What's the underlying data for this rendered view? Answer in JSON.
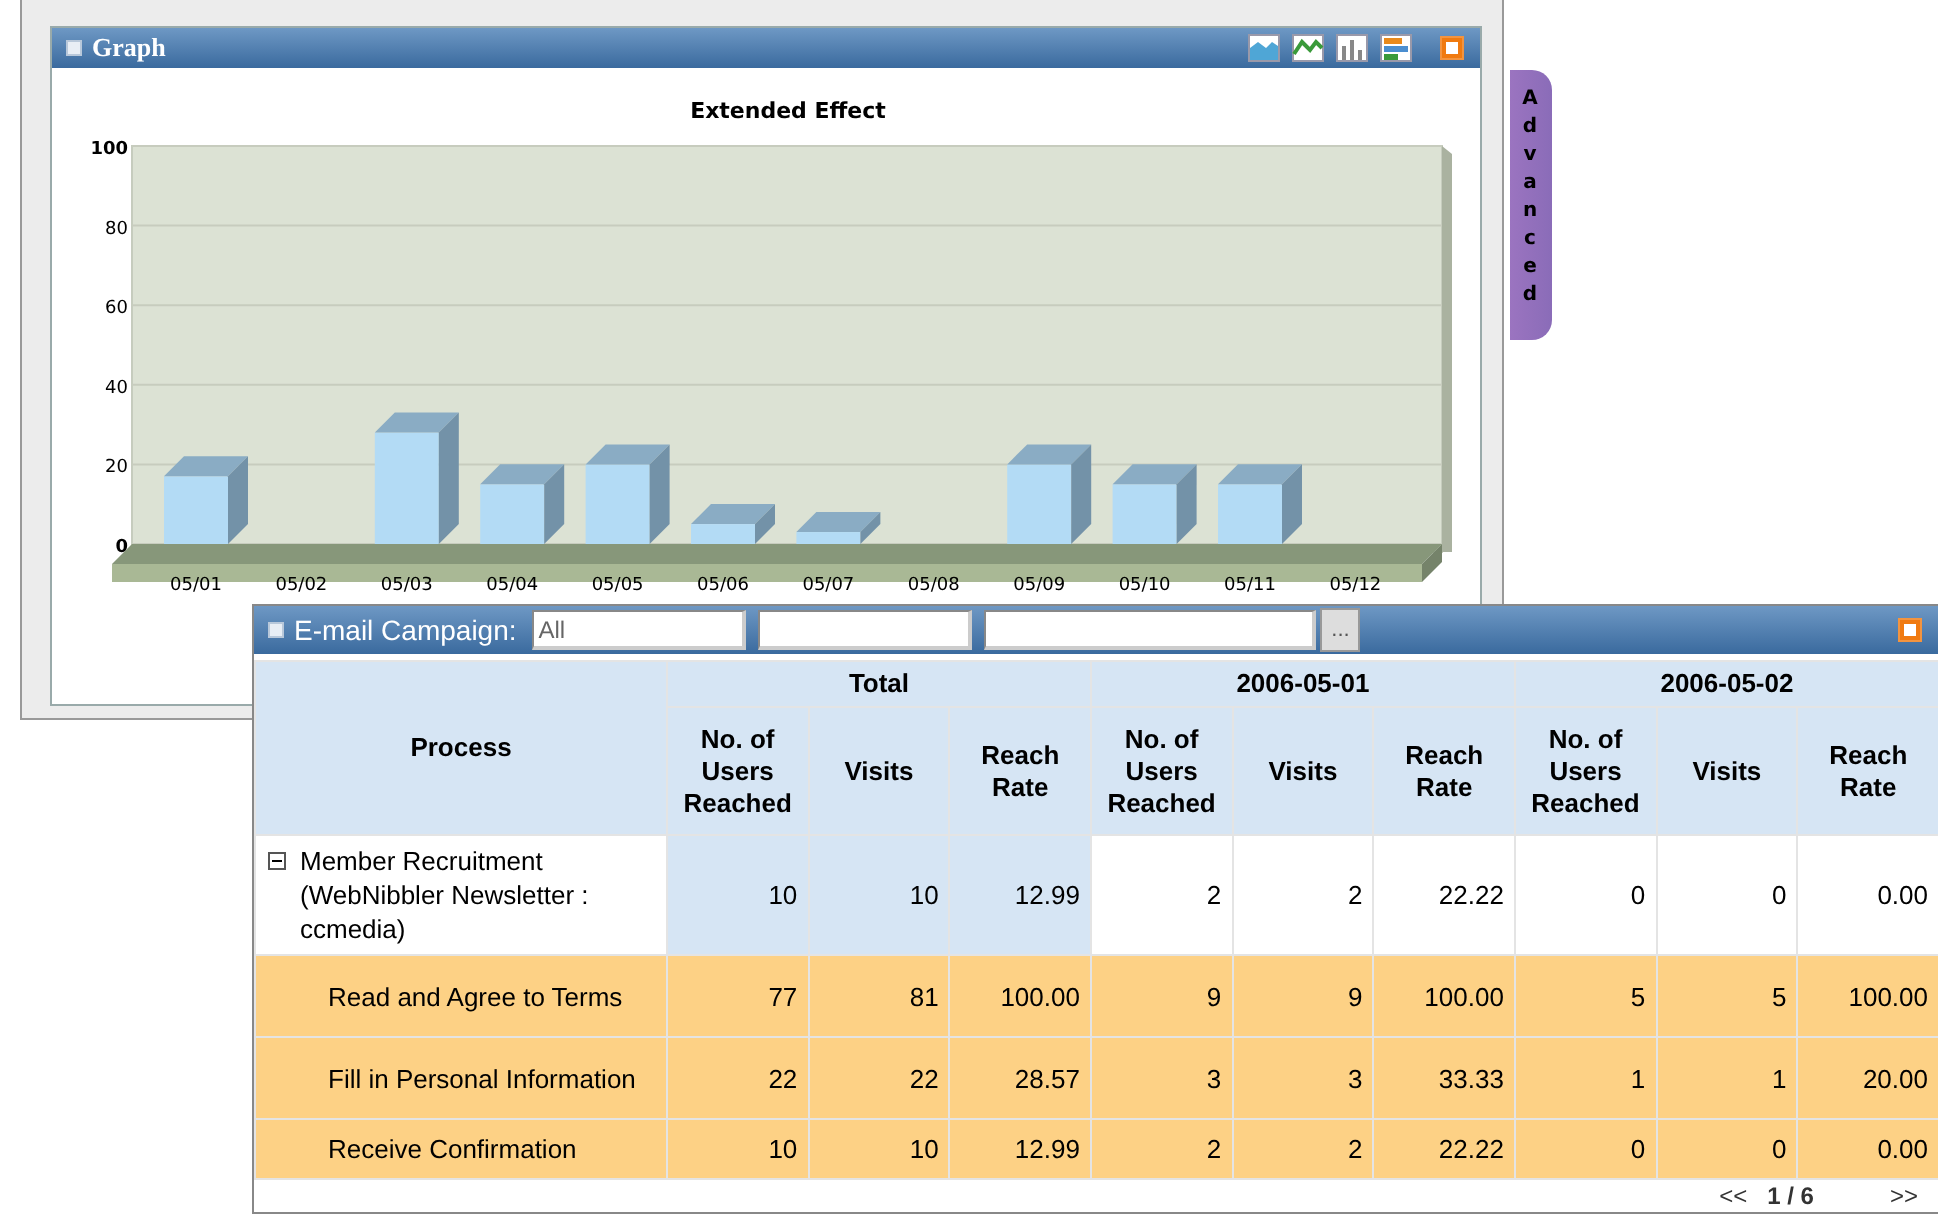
{
  "graph_panel": {
    "title": "Graph",
    "chart_types": [
      {
        "kind": "area"
      },
      {
        "kind": "line"
      },
      {
        "kind": "bar"
      },
      {
        "kind": "hbar"
      }
    ],
    "chart_data": {
      "type": "bar",
      "title": "Extended Effect",
      "categories": [
        "05/01",
        "05/02",
        "05/03",
        "05/04",
        "05/05",
        "05/06",
        "05/07",
        "05/08",
        "05/09",
        "05/10",
        "05/11",
        "05/12"
      ],
      "series": [
        {
          "color": "#b3dbf5",
          "values": [
            17,
            0,
            28,
            15,
            20,
            5,
            3,
            0,
            20,
            15,
            15,
            0
          ]
        }
      ],
      "ylim": [
        0,
        100
      ],
      "yticks": [
        0,
        20,
        40,
        60,
        80,
        100
      ],
      "grid": true
    }
  },
  "advanced_tab": {
    "label": "Advanced"
  },
  "campaign_panel": {
    "label": "E-mail Campaign:",
    "campaign_field": {
      "value": "All"
    },
    "browse_button": "...",
    "table": {
      "process_header": "Process",
      "groups": [
        {
          "label": "Total",
          "columns": [
            "No. of Users Reached",
            "Visits",
            "Reach Rate"
          ]
        },
        {
          "label": "2006-05-01",
          "columns": [
            "No. of Users Reached",
            "Visits",
            "Reach Rate"
          ]
        },
        {
          "label": "2006-05-02",
          "columns": [
            "No. of Users Reached",
            "Visits",
            "Reach Rate"
          ]
        }
      ],
      "rows": [
        {
          "process": "Member Recruitment (WebNibbler Newsletter : ccmedia)",
          "expanded": true,
          "cells": [
            "10",
            "10",
            "12.99",
            "2",
            "2",
            "22.22",
            "0",
            "0",
            "0.00"
          ],
          "children": [
            {
              "process": "Read and Agree to Terms",
              "cells": [
                "77",
                "81",
                "100.00",
                "9",
                "9",
                "100.00",
                "5",
                "5",
                "100.00"
              ]
            },
            {
              "process": "Fill in Personal Information",
              "cells": [
                "22",
                "22",
                "28.57",
                "3",
                "3",
                "33.33",
                "1",
                "1",
                "20.00"
              ]
            },
            {
              "process": "Receive Confirmation",
              "cells": [
                "10",
                "10",
                "12.99",
                "2",
                "2",
                "22.22",
                "0",
                "0",
                "0.00"
              ]
            }
          ]
        }
      ]
    },
    "pagination": {
      "previous": "<<",
      "page": "1 / 6",
      "next": ">>"
    }
  }
}
